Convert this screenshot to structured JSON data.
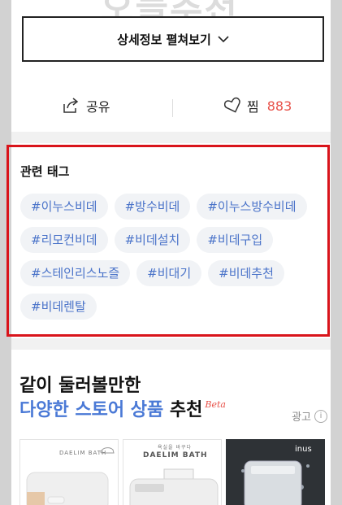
{
  "top": {
    "background_heading": "오늘추천",
    "detail_button_label": "상세정보 펼쳐보기"
  },
  "actions": {
    "share_label": "공유",
    "like_label": "찜",
    "like_count": "883"
  },
  "tags": {
    "title": "관련 태그",
    "items": [
      "#이누스비데",
      "#방수비데",
      "#이누스방수비데",
      "#리모컨비데",
      "#비데설치",
      "#비데구입",
      "#스테인리스노즐",
      "#비대기",
      "#비데추천",
      "#비데렌탈"
    ]
  },
  "recommend": {
    "line1": "같이 둘러볼만한",
    "line2_accent": "다양한 스토어 상품",
    "line2_rest": "추천",
    "beta": "Beta",
    "ad_label": "광고",
    "info_icon_glyph": "i"
  },
  "products": {
    "card1_brand": "DAELIM BATH",
    "card2_tagline": "욕실을 바꾸다",
    "card2_brand": "DAELIM BATH",
    "card3_brand": "inus"
  },
  "colors": {
    "accent_blue": "#4a79d6",
    "tag_text": "#4a73c9",
    "like_count": "#e8524a",
    "highlight_border": "#d9141b"
  },
  "icons": [
    "share-icon",
    "heart-icon",
    "chevron-down-icon",
    "info-icon"
  ]
}
